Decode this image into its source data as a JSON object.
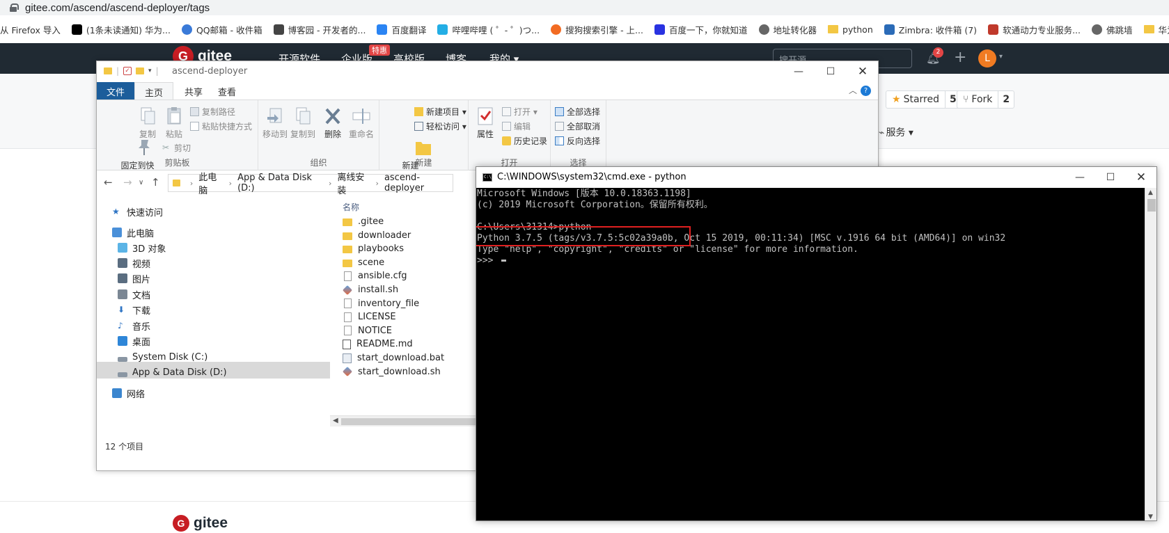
{
  "browser": {
    "url": "gitee.com/ascend/ascend-deployer/tags",
    "bookmarks": [
      {
        "label": "从 Firefox 导入",
        "icon": "none",
        "color": ""
      },
      {
        "label": "(1条未读通知) 华为...",
        "icon": "csdn-icon",
        "color": "#000000"
      },
      {
        "label": "QQ邮箱 - 收件箱",
        "icon": "qqmail-icon",
        "color": "#3a7ad8"
      },
      {
        "label": "博客园 - 开发者的...",
        "icon": "cnblogs-icon",
        "color": "#444444"
      },
      {
        "label": "百度翻译",
        "icon": "baidu-translate-icon",
        "color": "#2a84f3"
      },
      {
        "label": "哔哩哔哩 ( ゜- ゜)つ...",
        "icon": "bilibili-icon",
        "color": "#23aee5"
      },
      {
        "label": "搜狗搜索引擎 - 上...",
        "icon": "sogou-icon",
        "color": "#f26b22"
      },
      {
        "label": "百度一下，你就知道",
        "icon": "baidu-icon",
        "color": "#2932e1"
      },
      {
        "label": "地址转化器",
        "icon": "globe-icon",
        "color": "#666666"
      },
      {
        "label": "python",
        "icon": "folder-icon",
        "color": "#f3c744"
      },
      {
        "label": "Zimbra: 收件箱 (7)",
        "icon": "zimbra-icon",
        "color": "#2b6bb7"
      },
      {
        "label": "软通动力专业服务...",
        "icon": "isoftstone-icon",
        "color": "#c0392b"
      },
      {
        "label": "佛跳墙",
        "icon": "globe-icon",
        "color": "#666666"
      },
      {
        "label": "华为",
        "icon": "folder-icon",
        "color": "#f3c744"
      }
    ]
  },
  "gitee": {
    "logo_text": "gitee",
    "nav": [
      "开源软件",
      "企业版",
      "高校版",
      "博客",
      "我的 ▾"
    ],
    "hot_badge": "特惠",
    "search_placeholder": "搜开源",
    "notification_count": "2",
    "avatar_letter": "L",
    "starred_label": "Starred",
    "starred_count": "5",
    "fork_label": "Fork",
    "fork_count": "2",
    "services_label": "服务 ▾",
    "footer_logo_text": "gitee"
  },
  "explorer": {
    "title": "ascend-deployer",
    "tabs": [
      "文件",
      "主页",
      "共享",
      "查看"
    ],
    "ribbon": {
      "clipboard": {
        "group_label": "剪贴板",
        "pin": "固定到快\n速访问",
        "copy": "复制",
        "paste": "粘贴",
        "copy_path": "复制路径",
        "paste_shortcut": "粘贴快捷方式",
        "cut": "剪切"
      },
      "organize": {
        "group_label": "组织",
        "move_to": "移动到",
        "copy_to": "复制到",
        "delete": "删除",
        "rename": "重命名"
      },
      "new": {
        "group_label": "新建",
        "new_folder": "新建\n文件夹",
        "new_item": "新建项目 ▾",
        "easy_access": "轻松访问 ▾"
      },
      "open": {
        "group_label": "打开",
        "properties": "属性",
        "open": "打开 ▾",
        "edit": "编辑",
        "history": "历史记录"
      },
      "select": {
        "group_label": "选择",
        "select_all": "全部选择",
        "select_none": "全部取消",
        "invert": "反向选择"
      }
    },
    "breadcrumb": [
      "此电脑",
      "App & Data Disk (D:)",
      "离线安装",
      "ascend-deployer"
    ],
    "nav_pane": [
      {
        "label": "快速访问",
        "icon": "star-icon"
      },
      {
        "label": "此电脑",
        "icon": "computer-icon"
      },
      {
        "label": "3D 对象",
        "icon": "cube-icon"
      },
      {
        "label": "视频",
        "icon": "video-icon"
      },
      {
        "label": "图片",
        "icon": "picture-icon"
      },
      {
        "label": "文档",
        "icon": "document-icon"
      },
      {
        "label": "下载",
        "icon": "download-icon"
      },
      {
        "label": "音乐",
        "icon": "music-icon"
      },
      {
        "label": "桌面",
        "icon": "desktop-icon"
      },
      {
        "label": "System Disk (C:)",
        "icon": "drive-icon"
      },
      {
        "label": "App & Data Disk (D:)",
        "icon": "drive-icon"
      },
      {
        "label": "网络",
        "icon": "network-icon"
      }
    ],
    "column_name": "名称",
    "files": [
      {
        "name": ".gitee",
        "type": "folder"
      },
      {
        "name": "downloader",
        "type": "folder"
      },
      {
        "name": "playbooks",
        "type": "folder"
      },
      {
        "name": "scene",
        "type": "folder"
      },
      {
        "name": "ansible.cfg",
        "type": "doc"
      },
      {
        "name": "install.sh",
        "type": "git"
      },
      {
        "name": "inventory_file",
        "type": "doc"
      },
      {
        "name": "LICENSE",
        "type": "doc"
      },
      {
        "name": "NOTICE",
        "type": "doc"
      },
      {
        "name": "README.md",
        "type": "md"
      },
      {
        "name": "start_download.bat",
        "type": "bat"
      },
      {
        "name": "start_download.sh",
        "type": "git"
      }
    ],
    "status": "12 个项目"
  },
  "cmd": {
    "title": "C:\\WINDOWS\\system32\\cmd.exe - python",
    "icon_text": "C:\\",
    "lines": [
      "Microsoft Windows [版本 10.0.18363.1198]",
      "(c) 2019 Microsoft Corporation。保留所有权利。",
      "",
      "C:\\Users\\31314>python",
      "Python 3.7.5 (tags/v3.7.5:5c02a39a0b, Oct 15 2019, 00:11:34) [MSC v.1916 64 bit (AMD64)] on win32",
      "Type \"help\", \"copyright\", \"credits\" or \"license\" for more information.",
      ">>> "
    ]
  }
}
